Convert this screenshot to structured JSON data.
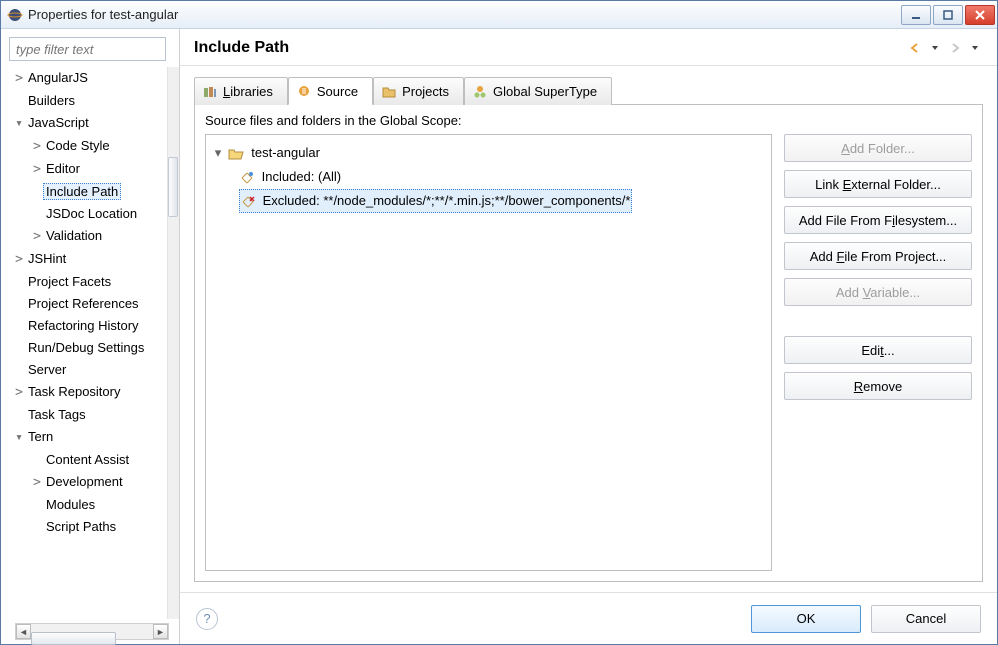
{
  "window": {
    "title": "Properties for test-angular"
  },
  "sidebar": {
    "filter_placeholder": "type filter text",
    "items": [
      {
        "label": "AngularJS",
        "depth": 0,
        "expand": ">"
      },
      {
        "label": "Builders",
        "depth": 0,
        "expand": ""
      },
      {
        "label": "JavaScript",
        "depth": 0,
        "expand": "▾"
      },
      {
        "label": "Code Style",
        "depth": 1,
        "expand": ">"
      },
      {
        "label": "Editor",
        "depth": 1,
        "expand": ">"
      },
      {
        "label": "Include Path",
        "depth": 1,
        "expand": "",
        "selected": true
      },
      {
        "label": "JSDoc Location",
        "depth": 1,
        "expand": ""
      },
      {
        "label": "Validation",
        "depth": 1,
        "expand": ">"
      },
      {
        "label": "JSHint",
        "depth": 0,
        "expand": ">"
      },
      {
        "label": "Project Facets",
        "depth": 0,
        "expand": ""
      },
      {
        "label": "Project References",
        "depth": 0,
        "expand": ""
      },
      {
        "label": "Refactoring History",
        "depth": 0,
        "expand": ""
      },
      {
        "label": "Run/Debug Settings",
        "depth": 0,
        "expand": ""
      },
      {
        "label": "Server",
        "depth": 0,
        "expand": ""
      },
      {
        "label": "Task Repository",
        "depth": 0,
        "expand": ">"
      },
      {
        "label": "Task Tags",
        "depth": 0,
        "expand": ""
      },
      {
        "label": "Tern",
        "depth": 0,
        "expand": "▾"
      },
      {
        "label": "Content Assist",
        "depth": 1,
        "expand": ""
      },
      {
        "label": "Development",
        "depth": 1,
        "expand": ">"
      },
      {
        "label": "Modules",
        "depth": 1,
        "expand": ""
      },
      {
        "label": "Script Paths",
        "depth": 1,
        "expand": ""
      }
    ]
  },
  "main": {
    "heading": "Include Path",
    "tabs": {
      "libraries": "Libraries",
      "source": "Source",
      "projects": "Projects",
      "global": "Global SuperType"
    },
    "panel": {
      "description": "Source files and folders in the Global Scope:",
      "tree": {
        "root": "test-angular",
        "included": "Included: (All)",
        "excluded": "Excluded: **/node_modules/*;**/*.min.js;**/bower_components/*"
      }
    },
    "buttons": {
      "add_folder": "Add Folder...",
      "link_external": "Link External Folder...",
      "add_file_fs": "Add File From Filesystem...",
      "add_file_proj": "Add File From Project...",
      "add_variable": "Add Variable...",
      "edit": "Edit...",
      "remove": "Remove"
    }
  },
  "footer": {
    "ok": "OK",
    "cancel": "Cancel"
  }
}
